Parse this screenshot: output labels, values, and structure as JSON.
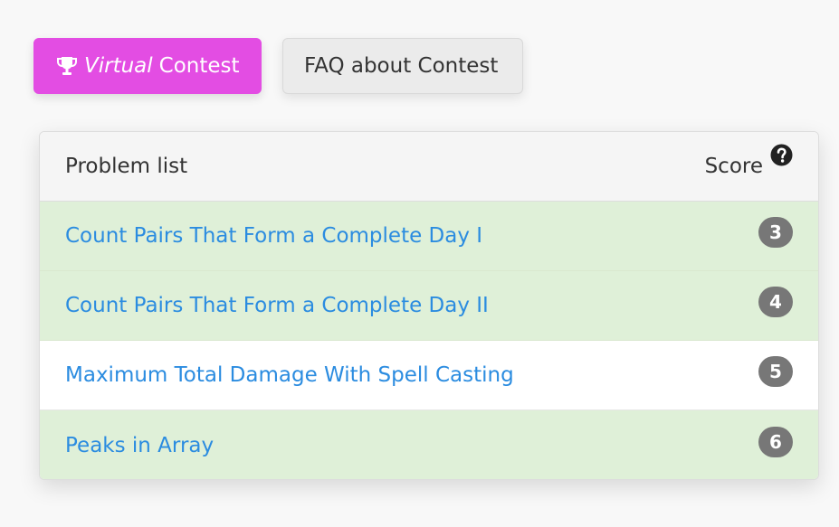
{
  "buttons": {
    "virtual_contest": {
      "italic_word": "Virtual",
      "rest": "Contest",
      "icon": "trophy-icon",
      "color": "#e34de3"
    },
    "faq": {
      "label": "FAQ about Contest"
    }
  },
  "problem_list": {
    "header": {
      "title": "Problem list",
      "score_label": "Score",
      "help_icon": "question-circle-icon"
    },
    "rows": [
      {
        "title": "Count Pairs That Form a Complete Day I",
        "score": "3",
        "status": "solved"
      },
      {
        "title": "Count Pairs That Form a Complete Day II",
        "score": "4",
        "status": "solved"
      },
      {
        "title": "Maximum Total Damage With Spell Casting",
        "score": "5",
        "status": "unsolved"
      },
      {
        "title": "Peaks in Array",
        "score": "6",
        "status": "solved"
      }
    ]
  },
  "colors": {
    "solved_row": "#dff0d8",
    "link": "#2b8ce0",
    "badge": "#777777"
  }
}
